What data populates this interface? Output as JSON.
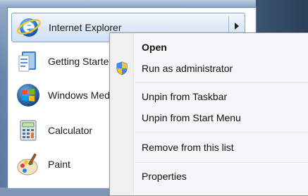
{
  "start_menu": {
    "programs": [
      {
        "label": "Internet Explorer",
        "icon": "internet-explorer-icon"
      },
      {
        "label": "Getting Started",
        "icon": "getting-started-icon"
      },
      {
        "label": "Windows Media Center",
        "icon": "windows-logo-icon"
      },
      {
        "label": "Calculator",
        "icon": "calculator-icon"
      },
      {
        "label": "Paint",
        "icon": "paint-icon"
      }
    ],
    "jumplist_arrow_icon": "chevron-right-icon"
  },
  "context_menu": {
    "open": "Open",
    "run_as_admin": "Run as administrator",
    "unpin_taskbar": "Unpin from Taskbar",
    "unpin_start": "Unpin from Start Menu",
    "remove_list": "Remove from this list",
    "properties": "Properties",
    "shield_icon": "uac-shield-icon"
  },
  "colors": {
    "highlight_border": "#7da2ce",
    "menu_background": "#f5f6f7"
  }
}
